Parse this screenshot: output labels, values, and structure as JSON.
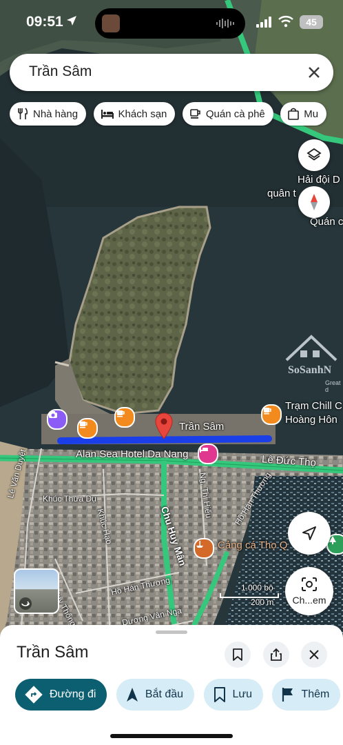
{
  "status_bar": {
    "time": "09:51",
    "battery": "45"
  },
  "search": {
    "value": "Trần Sâm"
  },
  "chips": [
    {
      "label": "Nhà hàng",
      "icon": "restaurant-icon"
    },
    {
      "label": "Khách sạn",
      "icon": "hotel-icon"
    },
    {
      "label": "Quán cà phê",
      "icon": "coffee-icon"
    },
    {
      "label": "Mu",
      "icon": "shopping-bag-icon"
    }
  ],
  "map": {
    "labels": {
      "hai_doi_line1": "Hải đội D",
      "hai_doi_line2": "quân t",
      "quan_c": "Quán c",
      "tram_chill_line1": "Trạm Chill C",
      "tram_chill_line2": "Hoàng Hôn",
      "pin": "Trần Sâm",
      "hotel": "Alan Sea Hotel Da Nang",
      "le_duc_tho": "Lê Đức Thọ",
      "cang_ca": "Cảng cá Thọ Q",
      "watermark": "SoSanhN",
      "watermark_sub": "Great d"
    },
    "streets": {
      "le_van_duyet": "Lê Văn Duyệt",
      "khuc_thua_du": "Khúc Thừa Dụ",
      "khuc_hao": "Khúc Hạo",
      "chu_huy_man": "Chu Huy Mân",
      "ng_thi_hieu": "Ng. Thị Hiếu",
      "ho_han_thuong_1": "Hồ Hán Thương",
      "ho_han_thuong_2": "Hồ Hán Thương",
      "duy_thong": "Huy Thông",
      "duong_van_nga": "Dương Vân Nga"
    },
    "scale": {
      "top": "1.000 bộ",
      "bottom": "200 m"
    },
    "streetview_label": "Ch...em"
  },
  "sheet": {
    "title": "Trần Sâm",
    "actions": [
      {
        "label": "Đường đi",
        "icon": "directions-icon"
      },
      {
        "label": "Bắt đầu",
        "icon": "navigation-icon"
      },
      {
        "label": "Lưu",
        "icon": "bookmark-icon"
      },
      {
        "label": "Thêm",
        "icon": "flag-icon"
      }
    ]
  },
  "colors": {
    "route": "#1a3ee8",
    "pin": "#e8453c",
    "road": "#35c77b",
    "accent": "#0b5f70"
  }
}
